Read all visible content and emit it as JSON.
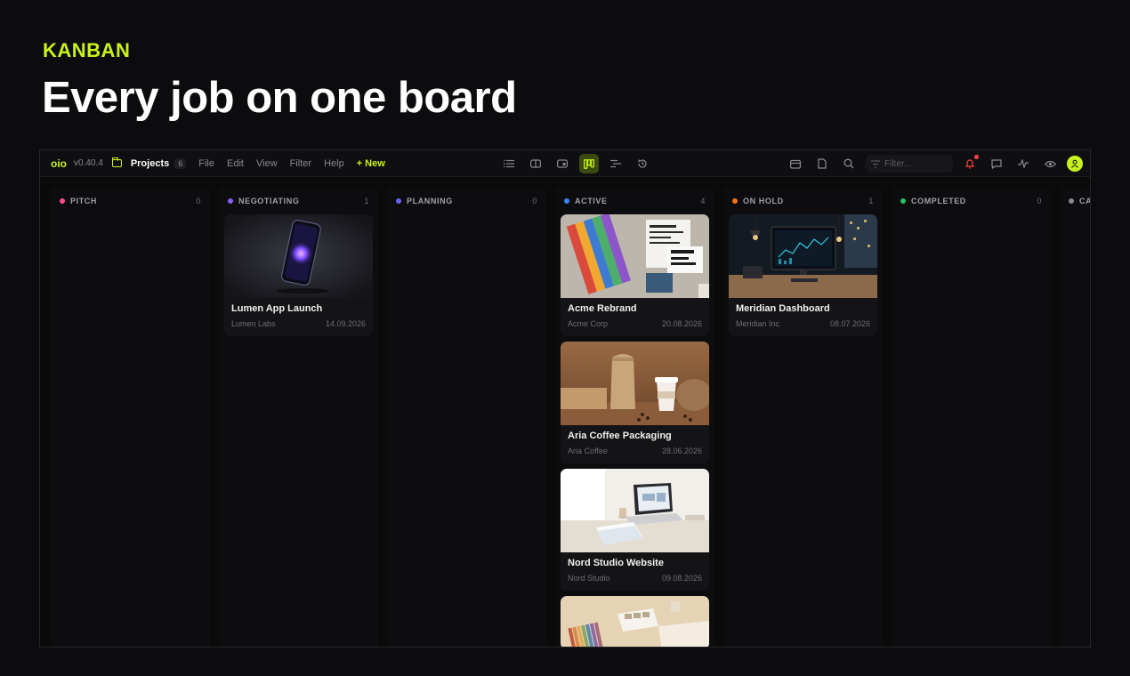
{
  "hero": {
    "eyebrow": "KANBAN",
    "title": "Every job on one board"
  },
  "app": {
    "logo": "oio",
    "version": "v0.40.4",
    "section": "Projects",
    "section_count": "6",
    "menu": [
      "File",
      "Edit",
      "View",
      "Filter",
      "Help"
    ],
    "new_label": "+ New",
    "filter_placeholder": "Filter...",
    "view_icons": [
      "list-view-icon",
      "card-view-icon",
      "gallery-view-icon",
      "kanban-view-icon",
      "timeline-view-icon",
      "history-icon"
    ],
    "right_icons": [
      "calendar-icon",
      "document-icon",
      "search-icon",
      "bell-icon",
      "chat-icon",
      "activity-icon",
      "eye-icon",
      "user-avatar-icon"
    ]
  },
  "colors": {
    "accent": "#c8f21c",
    "pitch": "#ff4d8d",
    "negotiating": "#8b5cf6",
    "planning": "#6366f1",
    "active": "#3b82f6",
    "on_hold": "#f97316",
    "completed": "#22c55e",
    "cancelled": "#8a8a8f"
  },
  "columns": [
    {
      "id": "pitch",
      "label": "PITCH",
      "count": "0",
      "color": "#ff4d8d",
      "cards": []
    },
    {
      "id": "negotiating",
      "label": "NEGOTIATING",
      "count": "1",
      "color": "#8b5cf6",
      "cards": [
        {
          "title": "Lumen App Launch",
          "client": "Lumen Labs",
          "date": "14.09.2026"
        }
      ]
    },
    {
      "id": "planning",
      "label": "PLANNING",
      "count": "0",
      "color": "#6366f1",
      "cards": []
    },
    {
      "id": "active",
      "label": "ACTIVE",
      "count": "4",
      "color": "#3b82f6",
      "cards": [
        {
          "title": "Acme Rebrand",
          "client": "Acme Corp",
          "date": "20.08.2026"
        },
        {
          "title": "Aria Coffee Packaging",
          "client": "Aria Coffee",
          "date": "28.06.2026"
        },
        {
          "title": "Nord Studio Website",
          "client": "Nord Studio",
          "date": "09.08.2026"
        }
      ]
    },
    {
      "id": "on_hold",
      "label": "ON HOLD",
      "count": "1",
      "color": "#f97316",
      "cards": [
        {
          "title": "Meridian Dashboard",
          "client": "Meridian Inc",
          "date": "08.07.2026"
        }
      ]
    },
    {
      "id": "completed",
      "label": "COMPLETED",
      "count": "0",
      "color": "#22c55e",
      "cards": []
    },
    {
      "id": "cancelled",
      "label": "CA",
      "count": "",
      "color": "#8a8a8f",
      "cards": []
    }
  ]
}
